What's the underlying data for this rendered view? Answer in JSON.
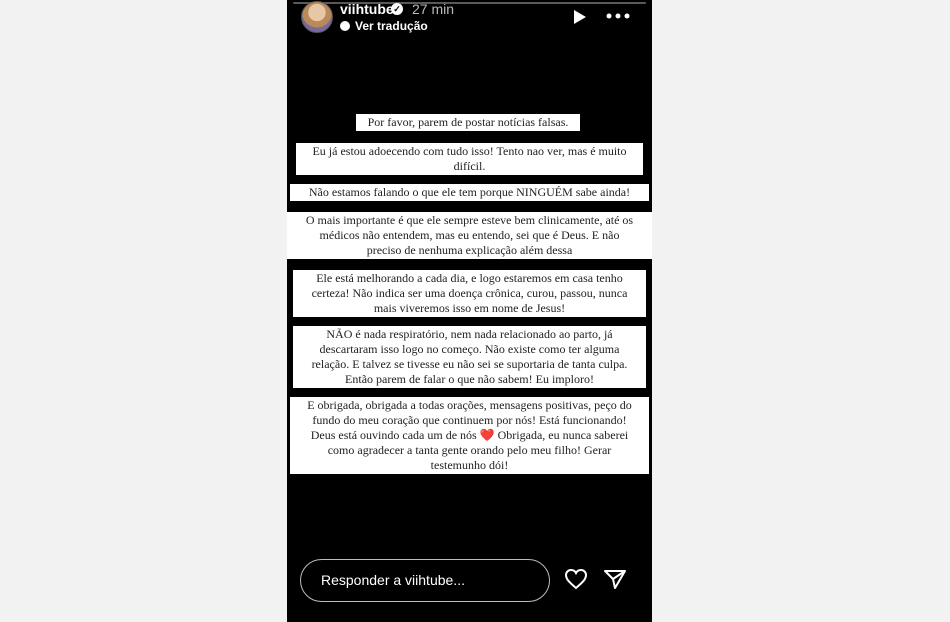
{
  "header": {
    "username": "viihtube",
    "time": "27 min",
    "translate_label": "Ver tradução"
  },
  "story": {
    "text_blocks": [
      "Por favor, parem de postar notícias falsas.",
      "Eu já estou adoecendo com tudo isso! Tento nao ver, mas é muito\ndifícil.",
      "Não estamos falando o que ele tem porque NINGUÉM sabe ainda!",
      "O mais importante é que ele sempre esteve bem clinicamente, até os\nmédicos não entendem, mas eu entendo, sei que é Deus. E não\npreciso de nenhuma explicação além dessa",
      "Ele está melhorando a cada dia, e logo estaremos em casa tenho\ncerteza! Não indica ser uma doença crônica, curou, passou, nunca\nmais viveremos isso em nome de Jesus!",
      "NÃO é nada respiratório, nem nada relacionado ao parto, já\ndescartaram isso logo no começo. Não existe como ter alguma\nrelação. E talvez se tivesse eu não sei se suportaria de tanta culpa.\nEntão parem de falar o que não sabem! Eu imploro!",
      "E obrigada, obrigada a todas orações, mensagens positivas, peço do\nfundo do meu coração que continuem por nós! Está funcionando!\nDeus está ouvindo cada um de nós ❤️ Obrigada, eu nunca saberei\ncomo agradecer a tanta gente orando pelo meu filho! Gerar\ntestemunho dói!"
    ]
  },
  "footer": {
    "reply_placeholder": "Responder a viihtube..."
  },
  "icons": {
    "verified": "verified-badge-icon",
    "translate": "translate-icon",
    "play": "play-icon",
    "more": "more-icon",
    "heart": "heart-icon",
    "send": "send-icon"
  }
}
